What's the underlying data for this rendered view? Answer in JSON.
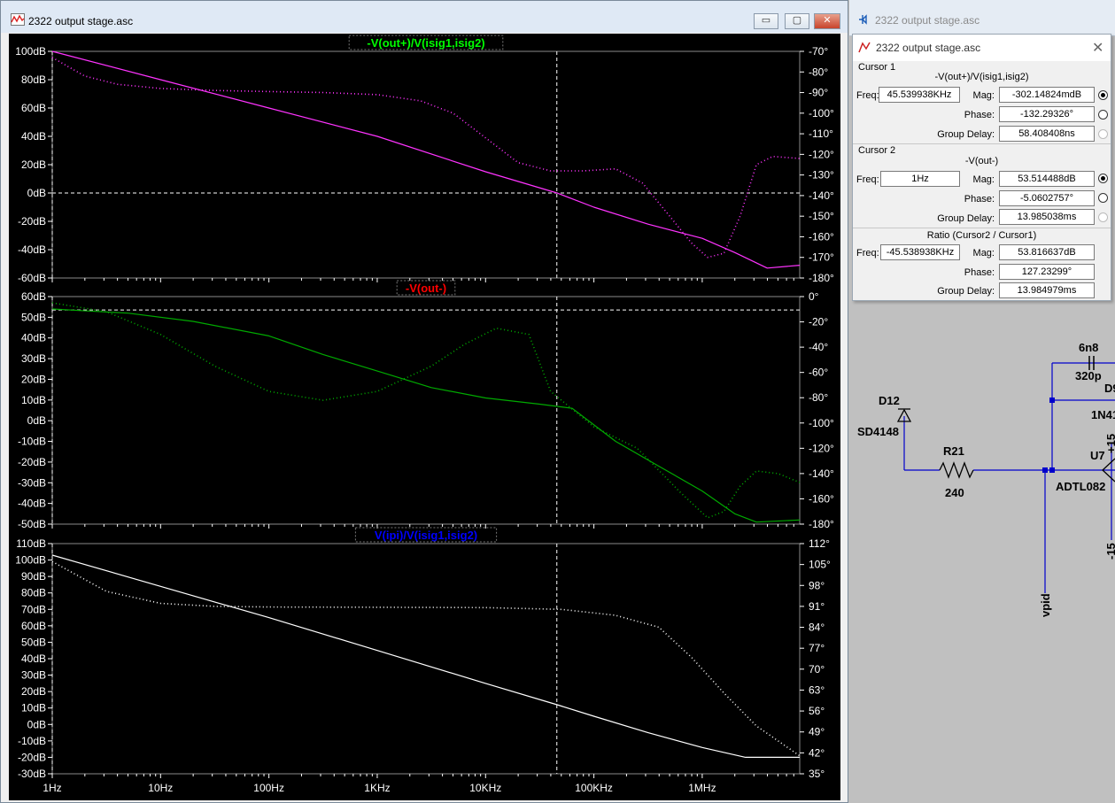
{
  "plot_window": {
    "title": "2322 output stage.asc",
    "buttons": {
      "minimize": "▭",
      "maximize": "▢",
      "close": "✕"
    }
  },
  "schematic_window": {
    "title": "2322 output stage.asc",
    "labels": [
      "6n8",
      "320p",
      "D12",
      "SD4148",
      "R21",
      "240",
      "U7",
      "ADTL082",
      "vpid",
      "1N41",
      "+15",
      "-15",
      "D9"
    ]
  },
  "cursor_dialog": {
    "title": "2322 output stage.asc",
    "cursor1": {
      "header": "Cursor 1",
      "trace": "-V(out+)/V(isig1,isig2)",
      "freq_label": "Freq:",
      "freq": "45.539938KHz",
      "mag_label": "Mag:",
      "mag": "-302.14824mdB",
      "phase_label": "Phase:",
      "phase": "-132.29326°",
      "gd_label": "Group Delay:",
      "gd": "58.408408ns"
    },
    "cursor2": {
      "header": "Cursor 2",
      "trace": "-V(out-)",
      "freq_label": "Freq:",
      "freq": "1Hz",
      "mag_label": "Mag:",
      "mag": "53.514488dB",
      "phase_label": "Phase:",
      "phase": "-5.0602757°",
      "gd_label": "Group Delay:",
      "gd": "13.985038ms"
    },
    "ratio": {
      "header": "Ratio (Cursor2 / Cursor1)",
      "freq_label": "Freq:",
      "freq": "-45.538938KHz",
      "mag_label": "Mag:",
      "mag": "53.816637dB",
      "phase_label": "Phase:",
      "phase": "127.23299°",
      "gd_label": "Group Delay:",
      "gd": "13.984979ms"
    }
  },
  "chart_data": [
    {
      "type": "line",
      "title": "-V(out+)/V(isig1,isig2)",
      "title_color": "#00ff00",
      "trace_color": "#ff33ff",
      "x_ticks": [
        "1Hz",
        "10Hz",
        "100Hz",
        "1KHz",
        "10KHz",
        "100KHz",
        "1MHz"
      ],
      "x_log_decades": [
        0,
        6.9
      ],
      "left_ticks": [
        "100dB",
        "80dB",
        "60dB",
        "40dB",
        "20dB",
        "0dB",
        "-20dB",
        "-40dB",
        "-60dB"
      ],
      "left_range": [
        -60,
        100
      ],
      "right_ticks": [
        "-70°",
        "-80°",
        "-90°",
        "-100°",
        "-110°",
        "-120°",
        "-130°",
        "-140°",
        "-150°",
        "-160°",
        "-170°",
        "-180°"
      ],
      "right_range": [
        -180,
        -70
      ],
      "cursor_freq_log": 4.658,
      "cursor_level_left": 0,
      "series": [
        {
          "name": "magnitude",
          "axis": "left",
          "style": "solid",
          "points": [
            [
              0,
              100
            ],
            [
              1,
              80
            ],
            [
              2,
              60
            ],
            [
              3,
              40
            ],
            [
              4,
              15
            ],
            [
              4.66,
              0
            ],
            [
              5,
              -10
            ],
            [
              5.5,
              -22
            ],
            [
              6,
              -32
            ],
            [
              6.3,
              -42
            ],
            [
              6.6,
              -53
            ],
            [
              6.9,
              -51
            ]
          ]
        },
        {
          "name": "phase",
          "axis": "right",
          "style": "dotted",
          "points": [
            [
              0,
              -73
            ],
            [
              0.3,
              -82
            ],
            [
              0.6,
              -86
            ],
            [
              1,
              -88
            ],
            [
              1.5,
              -89
            ],
            [
              2,
              -89.5
            ],
            [
              2.5,
              -90
            ],
            [
              3,
              -91
            ],
            [
              3.4,
              -94
            ],
            [
              3.7,
              -100
            ],
            [
              4,
              -112
            ],
            [
              4.3,
              -124
            ],
            [
              4.6,
              -128
            ],
            [
              4.9,
              -128
            ],
            [
              5.2,
              -127
            ],
            [
              5.45,
              -134
            ],
            [
              5.7,
              -150
            ],
            [
              5.9,
              -163
            ],
            [
              6.05,
              -170
            ],
            [
              6.2,
              -168
            ],
            [
              6.35,
              -150
            ],
            [
              6.5,
              -125
            ],
            [
              6.65,
              -121
            ],
            [
              6.9,
              -122
            ]
          ]
        }
      ]
    },
    {
      "type": "line",
      "title": "-V(out-)",
      "title_color": "#ff0000",
      "trace_color": "#00aa00",
      "x_ticks": [
        "1Hz",
        "10Hz",
        "100Hz",
        "1KHz",
        "10KHz",
        "100KHz",
        "1MHz"
      ],
      "x_log_decades": [
        0,
        6.9
      ],
      "left_ticks": [
        "60dB",
        "50dB",
        "40dB",
        "30dB",
        "20dB",
        "10dB",
        "0dB",
        "-10dB",
        "-20dB",
        "-30dB",
        "-40dB",
        "-50dB"
      ],
      "left_range": [
        -50,
        60
      ],
      "right_ticks": [
        "0°",
        "-20°",
        "-40°",
        "-60°",
        "-80°",
        "-100°",
        "-120°",
        "-140°",
        "-160°",
        "-180°"
      ],
      "right_range": [
        -180,
        0
      ],
      "cursor_freq_log": 4.658,
      "cursor_level_left": 53.5,
      "series": [
        {
          "name": "magnitude",
          "axis": "left",
          "style": "solid",
          "points": [
            [
              0,
              54
            ],
            [
              0.7,
              52
            ],
            [
              1.3,
              48
            ],
            [
              2,
              41
            ],
            [
              2.5,
              32
            ],
            [
              3,
              24
            ],
            [
              3.5,
              16
            ],
            [
              4,
              11
            ],
            [
              4.5,
              8
            ],
            [
              4.8,
              6
            ],
            [
              5.2,
              -10
            ],
            [
              5.6,
              -22
            ],
            [
              6,
              -34
            ],
            [
              6.3,
              -45
            ],
            [
              6.5,
              -49
            ],
            [
              6.9,
              -48
            ]
          ]
        },
        {
          "name": "phase",
          "axis": "right",
          "style": "dotted",
          "points": [
            [
              0,
              -5
            ],
            [
              0.5,
              -12
            ],
            [
              1,
              -30
            ],
            [
              1.5,
              -55
            ],
            [
              2,
              -75
            ],
            [
              2.5,
              -82
            ],
            [
              3,
              -75
            ],
            [
              3.5,
              -55
            ],
            [
              3.8,
              -38
            ],
            [
              4.1,
              -25
            ],
            [
              4.4,
              -30
            ],
            [
              4.6,
              -75
            ],
            [
              5,
              -103
            ],
            [
              5.4,
              -120
            ],
            [
              5.8,
              -155
            ],
            [
              6.05,
              -175
            ],
            [
              6.2,
              -170
            ],
            [
              6.35,
              -150
            ],
            [
              6.5,
              -138
            ],
            [
              6.7,
              -140
            ],
            [
              6.9,
              -147
            ]
          ]
        }
      ]
    },
    {
      "type": "line",
      "title": "V(ipi)/V(isig1,isig2)",
      "title_color": "#0000ff",
      "trace_color": "#ffffff",
      "x_ticks": [
        "1Hz",
        "10Hz",
        "100Hz",
        "1KHz",
        "10KHz",
        "100KHz",
        "1MHz"
      ],
      "x_log_decades": [
        0,
        6.9
      ],
      "left_ticks": [
        "110dB",
        "100dB",
        "90dB",
        "80dB",
        "70dB",
        "60dB",
        "50dB",
        "40dB",
        "30dB",
        "20dB",
        "10dB",
        "0dB",
        "-10dB",
        "-20dB",
        "-30dB"
      ],
      "left_range": [
        -30,
        110
      ],
      "right_ticks": [
        "112°",
        "105°",
        "98°",
        "91°",
        "84°",
        "77°",
        "70°",
        "63°",
        "56°",
        "49°",
        "42°",
        "35°"
      ],
      "right_range": [
        35,
        112
      ],
      "cursor_freq_log": 4.658,
      "series": [
        {
          "name": "magnitude",
          "axis": "left",
          "style": "solid",
          "points": [
            [
              0,
              103
            ],
            [
              1,
              84
            ],
            [
              2,
              65
            ],
            [
              3,
              45
            ],
            [
              4,
              25
            ],
            [
              4.66,
              12
            ],
            [
              5,
              5
            ],
            [
              5.5,
              -5
            ],
            [
              6,
              -14
            ],
            [
              6.4,
              -20
            ],
            [
              6.9,
              -20
            ]
          ]
        },
        {
          "name": "phase",
          "axis": "right",
          "style": "dotted",
          "points": [
            [
              0,
              106
            ],
            [
              0.5,
              96
            ],
            [
              1,
              92
            ],
            [
              1.5,
              91
            ],
            [
              2,
              90.8
            ],
            [
              3,
              90.7
            ],
            [
              4,
              90.6
            ],
            [
              4.7,
              90
            ],
            [
              5.2,
              88
            ],
            [
              5.6,
              84
            ],
            [
              5.9,
              74
            ],
            [
              6.2,
              62
            ],
            [
              6.5,
              51
            ],
            [
              6.9,
              41
            ]
          ]
        }
      ]
    }
  ]
}
